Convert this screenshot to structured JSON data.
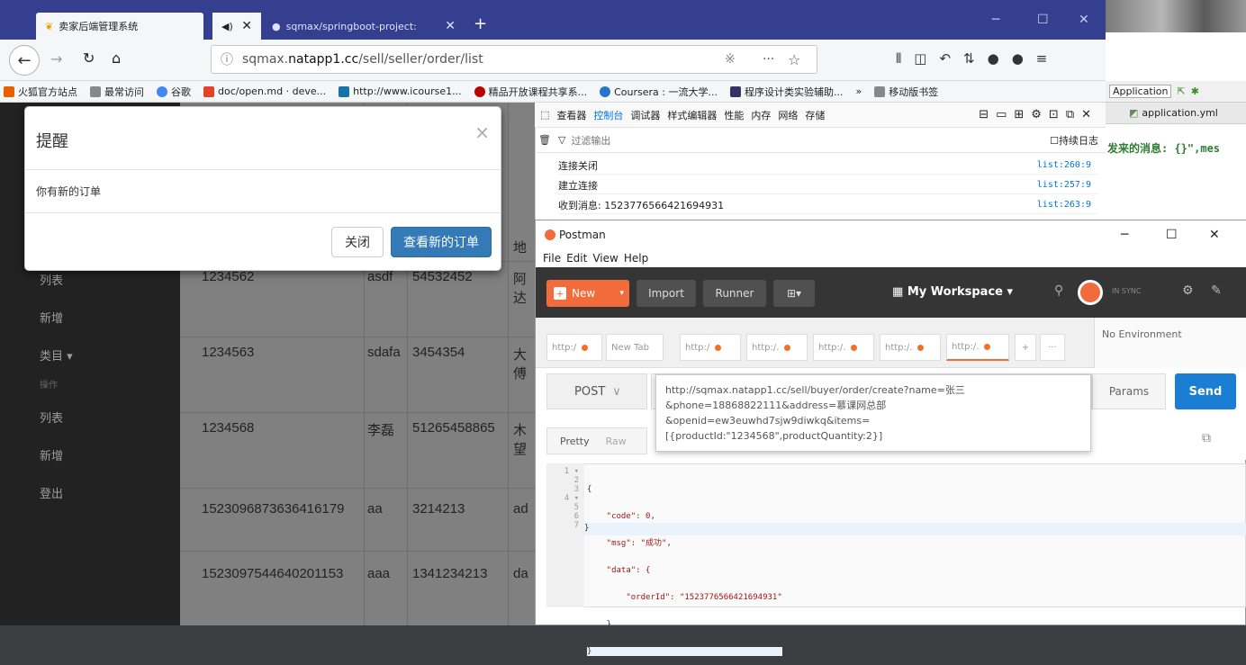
{
  "firefox": {
    "tabs": [
      {
        "label": "卖家后端管理系统"
      },
      {
        "label": "sqmax/springboot-project: "
      }
    ],
    "url_prefix": "sqmax.",
    "url_domain": "natapp1.cc",
    "url_path": "/sell/seller/order/list",
    "zoom_icon_text": "※",
    "more_text": "···",
    "bookmarks": [
      {
        "label": "火狐官方站点",
        "color": "#e66000"
      },
      {
        "label": "最常访问",
        "color": "#888"
      },
      {
        "label": "谷歌",
        "color": "#4285f4"
      },
      {
        "label": "doc/open.md · deve...",
        "color": "#e24329"
      },
      {
        "label": "http://www.icourse1...",
        "color": "#1a73a8"
      },
      {
        "label": "精品开放课程共享系...",
        "color": "#b00"
      },
      {
        "label": "Coursera : 一流大学...",
        "color": "#2a73cc"
      },
      {
        "label": "程序设计类实验辅助...",
        "color": "#336"
      },
      {
        "label": "»",
        "color": "transparent"
      },
      {
        "label": "移动版书签",
        "color": "#888"
      }
    ]
  },
  "ide": {
    "app_label": "Application",
    "file_tab": "application.yml",
    "log_text": "发来的消息: {}\",mes"
  },
  "page": {
    "sidebar": [
      {
        "label": "列表"
      },
      {
        "label": "新增"
      },
      {
        "label": "类目 ▾"
      },
      {
        "label": "操作"
      },
      {
        "label": "列表"
      },
      {
        "label": "新增"
      },
      {
        "label": "登出"
      }
    ],
    "header_partial": "地",
    "rows": [
      {
        "id": "1234562",
        "name": "asdf",
        "phone": "54532452",
        "addr": "阿达"
      },
      {
        "id": "1234563",
        "name": "sdafa",
        "phone": "3454354",
        "addr": "大傅"
      },
      {
        "id": "1234568",
        "name": "李磊",
        "phone": "51265458865",
        "addr": "木望"
      },
      {
        "id": "1523096873636416179",
        "name": "aa",
        "phone": "3214213",
        "addr": "ad"
      },
      {
        "id": "1523097544640201153",
        "name": "aaa",
        "phone": "1341234213",
        "addr": "da"
      }
    ]
  },
  "modal": {
    "title": "提醒",
    "close_x": "×",
    "body": "你有新的订单",
    "close_button": "关闭",
    "view_button": "查看新的订单"
  },
  "devtools": {
    "tabs": [
      "查看器",
      "控制台",
      "调试器",
      "样式编辑器",
      "性能",
      "内存",
      "网络",
      "存储"
    ],
    "filter_placeholder": "过滤输出",
    "persist_logs": "持续日志",
    "lines": [
      {
        "text": "连接关闭",
        "src": "list:260:9"
      },
      {
        "text": "建立连接",
        "src": "list:257:9"
      },
      {
        "text": "收到消息: 1523776566421694931",
        "src": "list:263:9"
      }
    ]
  },
  "postman": {
    "title": "Postman",
    "menu": [
      "File",
      "Edit",
      "View",
      "Help"
    ],
    "new_button": "New",
    "import_button": "Import",
    "runner_button": "Runner",
    "workspace": "My Workspace",
    "sync_label": "IN SYNC",
    "tabs": [
      "http:/",
      "New Tab",
      "http:/",
      "http:/.",
      "http:/.",
      "http:/.",
      "http:/."
    ],
    "add_tab": "+",
    "more_tabs": "···",
    "environment": "No Environment",
    "method": "POST",
    "params_button": "Params",
    "send_button": "Send",
    "pretty_tab": "Pretty",
    "raw_tab": "Raw",
    "url_tooltip_lines": [
      "http://sqmax.natapp1.cc/sell/buyer/order/create?name=张三",
      "&phone=18868822111&address=慕课网总部",
      "&openid=ew3euwhd7sjw9diwkq&items=",
      "[{productId:\"1234568\",productQuantity:2}]"
    ],
    "line_numbers": "1 ▾\n2\n3\n4 ▾\n5\n6\n7",
    "response_lines": [
      "{",
      "    \"code\": 0,",
      "    \"msg\": \"成功\",",
      "    \"data\": {",
      "        \"orderId\": \"1523776566421694931\"",
      "    }",
      "}"
    ]
  },
  "colors": {
    "firefox_tabbar": "#343f8f",
    "bootstrap_primary": "#337ab7",
    "postman_orange": "#f26b3a",
    "postman_send": "#1a7fd4"
  }
}
